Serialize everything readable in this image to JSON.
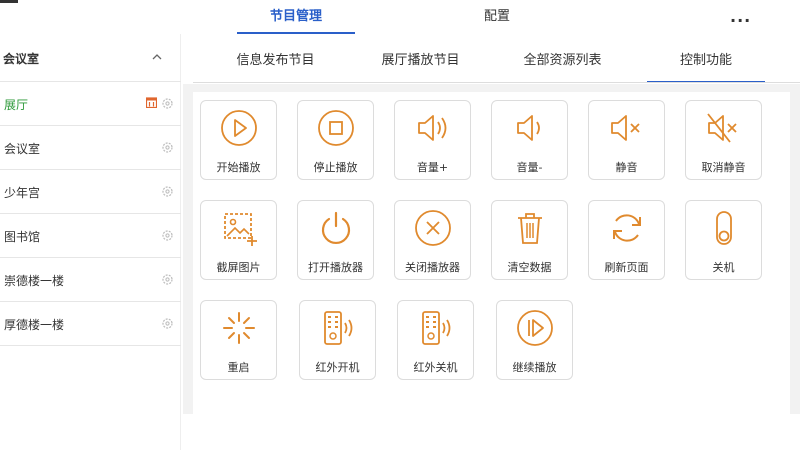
{
  "header": {
    "tabs": [
      {
        "label": "节目管理",
        "active": true
      },
      {
        "label": "配置",
        "active": false
      }
    ],
    "more_label": "..."
  },
  "sidebar": {
    "group_title": "会议室",
    "items": [
      {
        "label": "展厅",
        "active": true
      },
      {
        "label": "会议室",
        "active": false
      },
      {
        "label": "少年宫",
        "active": false
      },
      {
        "label": "图书馆",
        "active": false
      },
      {
        "label": "崇德楼一楼",
        "active": false
      },
      {
        "label": "厚德楼一楼",
        "active": false
      }
    ]
  },
  "subtabs": [
    {
      "label": "信息发布节目",
      "active": false
    },
    {
      "label": "展厅播放节目",
      "active": false
    },
    {
      "label": "全部资源列表",
      "active": false
    },
    {
      "label": "控制功能",
      "active": true
    }
  ],
  "controls": [
    {
      "label": "开始播放",
      "icon": "play-icon"
    },
    {
      "label": "停止播放",
      "icon": "stop-icon"
    },
    {
      "label": "音量+",
      "icon": "volume-up-icon"
    },
    {
      "label": "音量-",
      "icon": "volume-down-icon"
    },
    {
      "label": "静音",
      "icon": "mute-icon"
    },
    {
      "label": "取消静音",
      "icon": "unmute-icon"
    },
    {
      "label": "截屏图片",
      "icon": "screenshot-icon"
    },
    {
      "label": "打开播放器",
      "icon": "power-on-icon"
    },
    {
      "label": "关闭播放器",
      "icon": "close-circle-icon"
    },
    {
      "label": "清空数据",
      "icon": "trash-icon"
    },
    {
      "label": "刷新页面",
      "icon": "refresh-icon"
    },
    {
      "label": "关机",
      "icon": "shutdown-toggle-icon"
    },
    {
      "label": "重启",
      "icon": "restart-icon"
    },
    {
      "label": "红外开机",
      "icon": "ir-remote-on-icon"
    },
    {
      "label": "红外关机",
      "icon": "ir-remote-off-icon"
    },
    {
      "label": "继续播放",
      "icon": "resume-play-icon"
    }
  ],
  "colors": {
    "accent": "#2a5fc9",
    "icon": "#e08a2e",
    "active_item": "#2e9a3a",
    "calendar_icon": "#e0662e"
  }
}
